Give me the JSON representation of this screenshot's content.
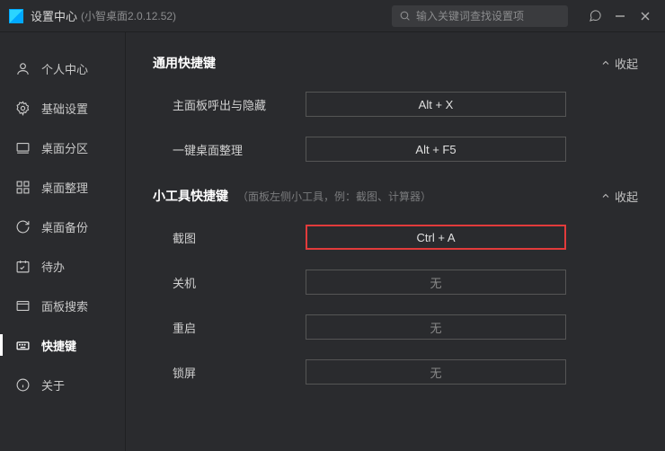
{
  "titlebar": {
    "title": "设置中心",
    "version": "(小智桌面2.0.12.52)",
    "search_placeholder": "输入关键词查找设置项"
  },
  "sidebar": {
    "items": [
      {
        "label": "个人中心"
      },
      {
        "label": "基础设置"
      },
      {
        "label": "桌面分区"
      },
      {
        "label": "桌面整理"
      },
      {
        "label": "桌面备份"
      },
      {
        "label": "待办"
      },
      {
        "label": "面板搜索"
      },
      {
        "label": "快捷键"
      },
      {
        "label": "关于"
      }
    ],
    "active_index": 7
  },
  "sections": {
    "general": {
      "title": "通用快捷键",
      "collapse": "收起",
      "rows": [
        {
          "label": "主面板呼出与隐藏",
          "value": "Alt + X"
        },
        {
          "label": "一键桌面整理",
          "value": "Alt + F5"
        }
      ]
    },
    "widgets": {
      "title": "小工具快捷键",
      "hint": "（面板左侧小工具，例：截图、计算器）",
      "collapse": "收起",
      "rows": [
        {
          "label": "截图",
          "value": "Ctrl + A",
          "highlight": true
        },
        {
          "label": "关机",
          "value": "无",
          "empty": true
        },
        {
          "label": "重启",
          "value": "无",
          "empty": true
        },
        {
          "label": "锁屏",
          "value": "无",
          "empty": true
        }
      ]
    }
  }
}
